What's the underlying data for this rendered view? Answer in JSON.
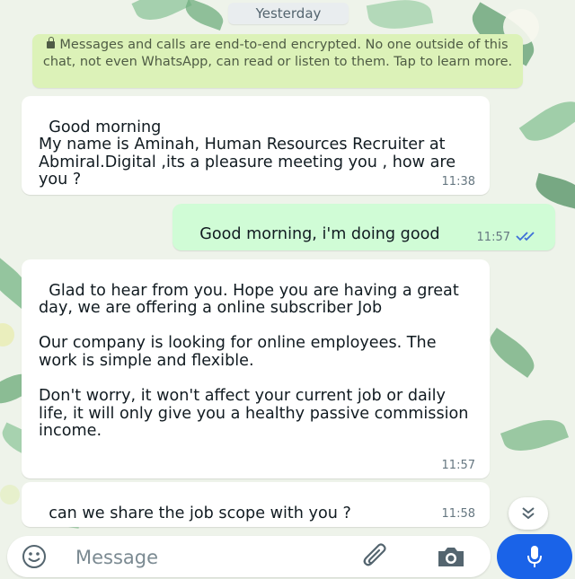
{
  "date_divider": "Yesterday",
  "encryption_notice": {
    "text": "Messages and calls are end-to-end encrypted. No one outside of this chat, not even WhatsApp, can read or listen to them. Tap to learn more.",
    "icon": "lock-icon"
  },
  "messages": [
    {
      "direction": "incoming",
      "text": "Good morning\nMy name is Aminah, Human Resources Recruiter at Abmiral.Digital ,its a pleasure meeting you , how are you ?",
      "time": "11:38"
    },
    {
      "direction": "outgoing",
      "text": "Good morning, i'm doing good",
      "time": "11:57",
      "status": "read",
      "status_icon": "double-check-icon"
    },
    {
      "direction": "incoming",
      "text": "Glad to hear from you. Hope you are having a great day, we are offering a online subscriber Job\n\nOur company is looking for online employees. The work is simple and flexible.\n\nDon't worry, it won't affect your current job or daily life, it will only give you a healthy passive commission income.",
      "time": "11:57"
    },
    {
      "direction": "incoming",
      "text": "can we share the job scope with you ?",
      "time": "11:58"
    }
  ],
  "composer": {
    "placeholder": "Message",
    "icons": [
      "emoji-icon",
      "paperclip-icon",
      "camera-icon",
      "mic-icon"
    ]
  },
  "colors": {
    "incoming_bubble": "#ffffff",
    "outgoing_bubble": "#d0fcd6",
    "encryption_notice_bg": "#dcf2b8",
    "read_ticks": "#3d6fd8",
    "mic_button": "#1a63e8"
  }
}
